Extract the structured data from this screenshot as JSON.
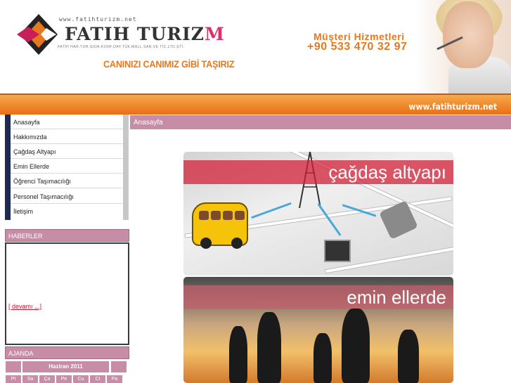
{
  "header": {
    "url_text": "www.fatihturizm.net",
    "brand_main": "FATIH TURIZ",
    "brand_accent": "M",
    "company_line": "FATİH HAR.TUR.GIDA.KONF.DAY.TÜK.MALL.SAN.VE TİC.LTD.ŞTİ.",
    "slogan": "CANINIZI CANIMIZ GİBİ TAŞIRIZ",
    "customer_service_title": "Müşteri Hizmetleri",
    "customer_service_phone": "+90 533 470 32 97",
    "site_url_band": "www.fatihturizm.net"
  },
  "menu": {
    "items": [
      {
        "label": "Anasayfa"
      },
      {
        "label": "Hakkımızda"
      },
      {
        "label": "Çağdaş Altyapı"
      },
      {
        "label": "Emin Ellerde"
      },
      {
        "label": "Öğrenci Taşımacılığı"
      },
      {
        "label": "Personel Taşımacılığı"
      },
      {
        "label": "İletişim"
      }
    ]
  },
  "news": {
    "title": "HABERLER",
    "more_link": "[ devamı ...]"
  },
  "agenda": {
    "title": "AJANDA",
    "month": "Haziran 2011",
    "days": [
      "Pt",
      "Sa",
      "Ça",
      "Pe",
      "Cu",
      "Ct",
      "Pa"
    ]
  },
  "main": {
    "page_title": "Anasayfa",
    "banner1_text": "çağdaş altyapı",
    "banner2_text": "emin ellerde"
  },
  "colors": {
    "accent_orange": "#e8781e",
    "box_pink": "#c78ca6",
    "sidebar_navy": "#1f2a52"
  }
}
